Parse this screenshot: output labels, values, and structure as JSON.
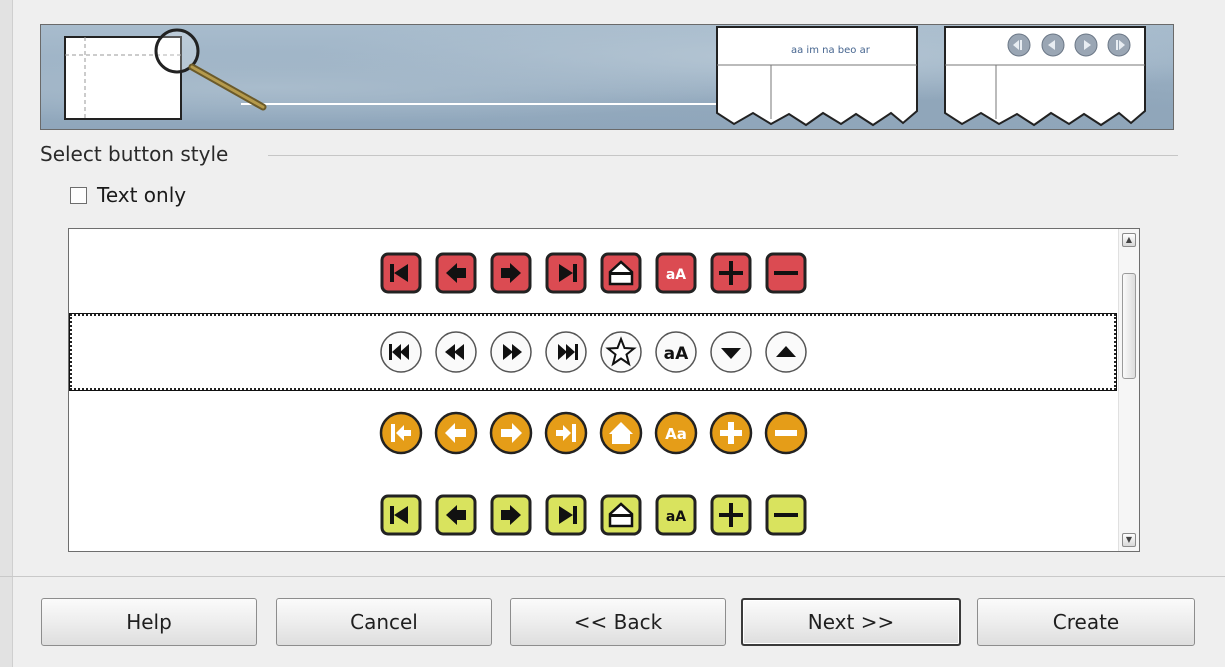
{
  "section": {
    "label": "Select button style"
  },
  "text_only": {
    "label": "Text only",
    "checked": false
  },
  "preview": {
    "nav_text": "aa im na beo ar"
  },
  "button_styles": [
    {
      "name": "red-square",
      "color": "#d9414a",
      "icons": [
        "first",
        "prev",
        "next",
        "last",
        "home",
        "text-size",
        "plus",
        "minus"
      ]
    },
    {
      "name": "grey-round",
      "color": "#ffffff",
      "icons": [
        "first",
        "prev",
        "next",
        "last",
        "star",
        "text-size",
        "down",
        "up"
      ],
      "selected": true
    },
    {
      "name": "orange-round",
      "color": "#e49c18",
      "icons": [
        "first",
        "prev",
        "next",
        "last",
        "home",
        "text-size",
        "plus",
        "minus"
      ]
    },
    {
      "name": "yellow-square",
      "color": "#d8e35c",
      "icons": [
        "first",
        "prev",
        "next",
        "last",
        "home",
        "text-size",
        "plus",
        "minus"
      ]
    }
  ],
  "footer": {
    "help": "Help",
    "cancel": "Cancel",
    "back": "<< Back",
    "next": "Next >>",
    "create": "Create"
  }
}
